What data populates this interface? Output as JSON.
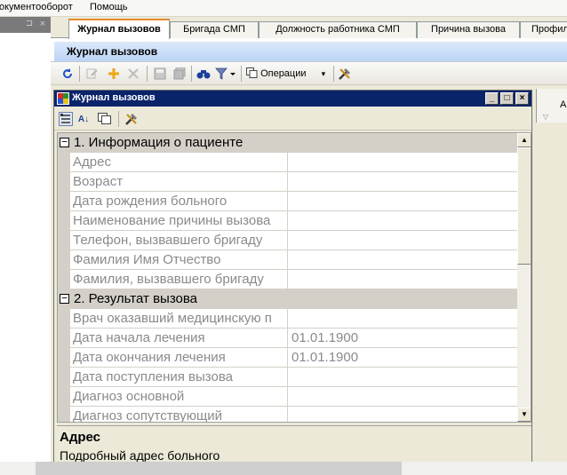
{
  "menu": {
    "items": [
      {
        "label": "окументооборот"
      },
      {
        "label": "Помощь"
      }
    ]
  },
  "left_panel": {
    "close_glyph": "×",
    "pin_glyph": "⊐"
  },
  "tabs": [
    {
      "label": "Журнал вызовов",
      "active": true
    },
    {
      "label": "Бригада СМП",
      "active": false
    },
    {
      "label": "Должность работника СМП",
      "active": false
    },
    {
      "label": "Причина вызова",
      "active": false
    },
    {
      "label": "Профил",
      "active": false
    }
  ],
  "doc": {
    "title": "Журнал вызовов"
  },
  "toolbar": {
    "operations_label": "Операции",
    "operations_arrow": "▾",
    "icons": [
      "refresh-icon",
      "edit-icon",
      "add-icon",
      "delete-icon",
      "save-icon",
      "save-all-icon",
      "find-icon",
      "filter-icon",
      "operations-icon",
      "tools-icon"
    ]
  },
  "right_panel": {
    "letter": "А",
    "arrow": "▽"
  },
  "inner_window": {
    "title": "Журнал вызовов",
    "buttons": {
      "minimize": "_",
      "maximize": "□",
      "close": "×"
    },
    "toolbar_icons": [
      "categorized-icon",
      "alphabetical-icon",
      "pages-icon",
      "tools-icon"
    ],
    "alpha_glyph": "A↓"
  },
  "grid": {
    "categories": [
      {
        "toggle": "−",
        "label": "1. Информация о пациенте",
        "properties": [
          {
            "name": "Адрес",
            "value": ""
          },
          {
            "name": "Возраст",
            "value": ""
          },
          {
            "name": "Дата рождения больного",
            "value": ""
          },
          {
            "name": "Наименование причины вызова",
            "value": ""
          },
          {
            "name": "Телефон, вызвавшего бригаду",
            "value": ""
          },
          {
            "name": "Фамилия Имя Отчество",
            "value": ""
          },
          {
            "name": "Фамилия, вызвавшего бригаду",
            "value": ""
          }
        ]
      },
      {
        "toggle": "−",
        "label": "2. Результат вызова",
        "properties": [
          {
            "name": "Врач оказавший медицинскую п",
            "value": ""
          },
          {
            "name": "Дата начала лечения",
            "value": "01.01.1900"
          },
          {
            "name": "Дата окончания лечения",
            "value": "01.01.1900"
          },
          {
            "name": "Дата поступления вызова",
            "value": ""
          },
          {
            "name": "Диагноз основной",
            "value": ""
          },
          {
            "name": "Диагноз сопутствующий",
            "value": ""
          }
        ]
      }
    ],
    "scroll_up": "▲",
    "scroll_down": "▼"
  },
  "description": {
    "title": "Адрес",
    "text": "Подробный адрес больного"
  },
  "colors": {
    "accent_tab": "#e68b2c",
    "window_title": "#0a246a",
    "doc_header": "#bcd4f6"
  }
}
